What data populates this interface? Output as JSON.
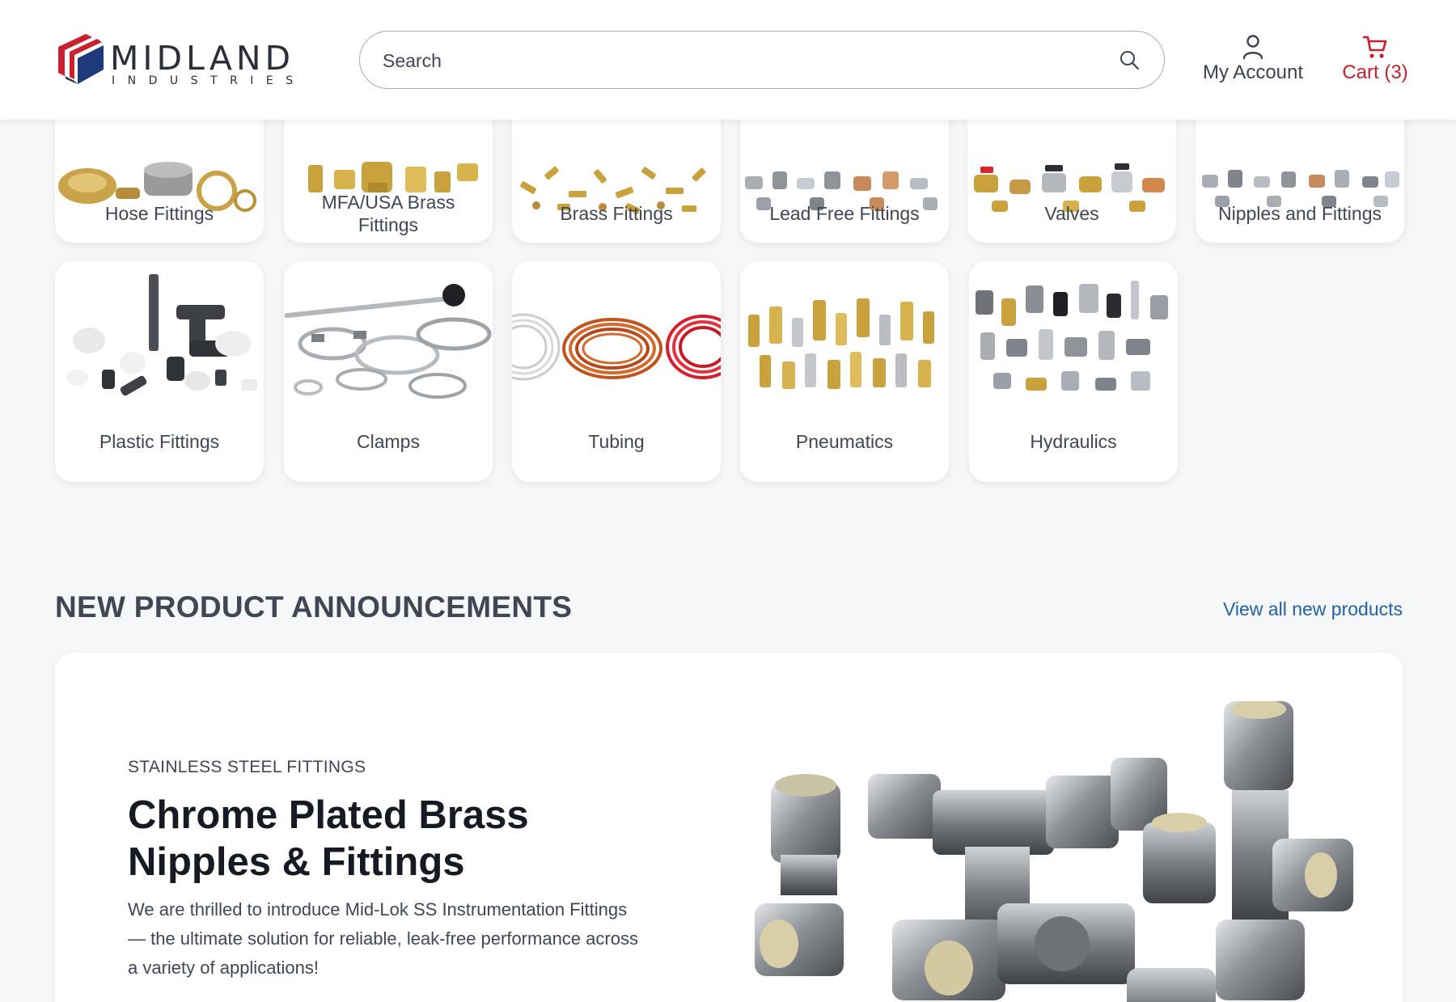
{
  "brand": {
    "name": "MIDLAND",
    "tagline": "INDUSTRIES",
    "colors": {
      "red": "#c8202f",
      "navy": "#1f3a7a",
      "dark": "#2a2f3a"
    }
  },
  "header": {
    "search": {
      "placeholder": "Search",
      "icon": "search-icon"
    },
    "account": {
      "label": "My Account",
      "icon": "user-icon"
    },
    "cart": {
      "label": "Cart (3)",
      "icon": "cart-icon",
      "color": "#c8202f"
    }
  },
  "categories": [
    {
      "label": "Hose Fittings"
    },
    {
      "label": "MFA/USA Brass Fittings"
    },
    {
      "label": "Brass Fittings"
    },
    {
      "label": "Lead Free Fittings"
    },
    {
      "label": "Valves"
    },
    {
      "label": "Nipples and Fittings"
    },
    {
      "label": "Plastic Fittings"
    },
    {
      "label": "Clamps"
    },
    {
      "label": "Tubing"
    },
    {
      "label": "Pneumatics"
    },
    {
      "label": "Hydraulics"
    }
  ],
  "announcements": {
    "title": "NEW PRODUCT ANNOUNCEMENTS",
    "view_all": "View all new products",
    "featured": {
      "eyebrow": "STAINLESS STEEL FITTINGS",
      "headline": "Chrome Plated Brass Nipples & Fittings",
      "body": "We are thrilled to introduce Mid-Lok SS Instrumentation Fittings — the ultimate solution for reliable, leak-free performance across a variety of applications!"
    }
  },
  "colors": {
    "page_bg": "#f6f7f9",
    "link": "#1f62a8",
    "accent": "#c8202f"
  }
}
